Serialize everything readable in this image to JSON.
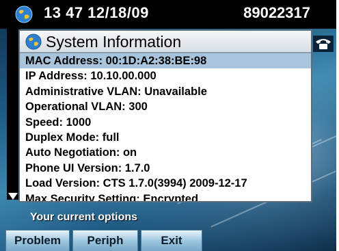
{
  "header": {
    "time_date": "13 47 12/18/09",
    "extension": "89022317"
  },
  "dialog": {
    "title": "System Information",
    "items": [
      "MAC Address: 00:1D:A2:38:BE:98",
      "IP Address: 10.10.00.000",
      "Administrative VLAN: Unavailable",
      "Operational VLAN: 300",
      "Speed: 1000",
      "Duplex Mode: full",
      "Auto Negotiation: on",
      "Phone UI Version: 1.7.0",
      "Load Version: CTS 1.7.0(3994) 2009-12-17",
      "Max Security Setting: Encrypted"
    ],
    "selected_index": 0
  },
  "options_bar": {
    "text": "Your current options"
  },
  "softkeys": {
    "problem": "Problem",
    "periph": "Periph",
    "exit": "Exit"
  },
  "icons": {
    "header": "globe-icon",
    "title": "globe-icon",
    "line": "phone-icon",
    "scroll": "down-arrow-icon"
  },
  "colors": {
    "header_bg": "#000000",
    "selection": "#a9c5dd",
    "softkey": "#9ec6de"
  }
}
